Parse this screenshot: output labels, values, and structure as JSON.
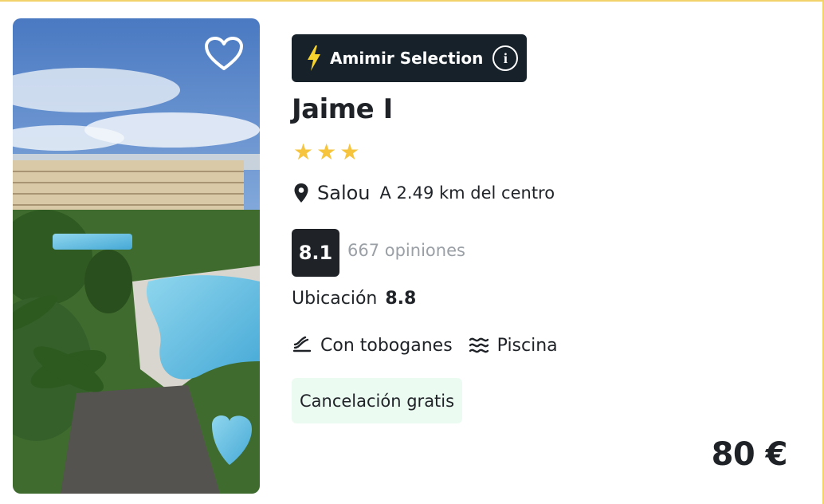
{
  "hotel": {
    "photo_alt": "",
    "badge": {
      "label": "Amimir Selection",
      "info_icon": "i"
    },
    "name": "Jaime I",
    "stars": 3,
    "location": {
      "city": "Salou",
      "distance": "A 2.49 km del centro"
    },
    "rating": {
      "score": "8.1",
      "reviews": "667 opiniones"
    },
    "location_rating": {
      "label": "Ubicación",
      "score": "8.8"
    },
    "amenities": [
      {
        "icon": "slide-icon",
        "label": "Con toboganes"
      },
      {
        "icon": "waves-icon",
        "label": "Piscina"
      }
    ],
    "cancellation": "Cancelación gratis",
    "price": "80 €"
  },
  "colors": {
    "star": "#f6c43d",
    "badge_bg": "#16212a",
    "bolt": "#f6d32d",
    "cancel_bg": "#ecfbf1",
    "card_border": "#f2d36b"
  }
}
